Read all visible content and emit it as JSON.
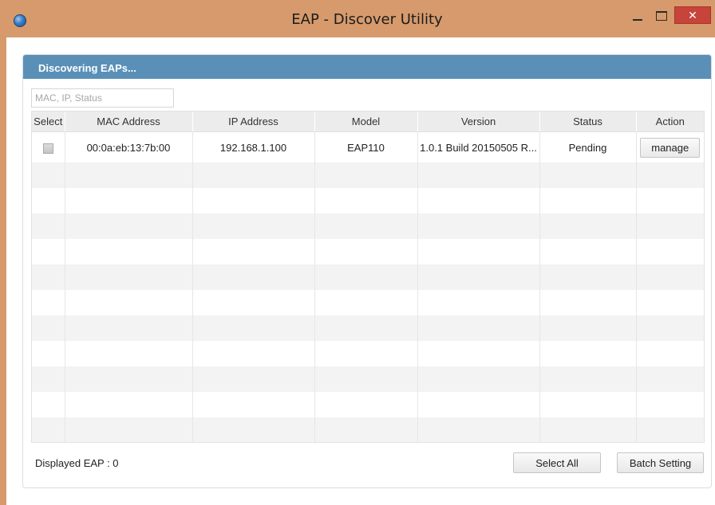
{
  "window": {
    "title": "EAP - Discover Utility",
    "close_glyph": "✕"
  },
  "panel": {
    "header": "Discovering EAPs..."
  },
  "search": {
    "placeholder": "MAC, IP, Status",
    "value": ""
  },
  "table": {
    "columns": [
      "Select",
      "MAC Address",
      "IP Address",
      "Model",
      "Version",
      "Status",
      "Action"
    ],
    "rows": [
      {
        "selected": false,
        "mac": "00:0a:eb:13:7b:00",
        "ip": "192.168.1.100",
        "model": "EAP110",
        "version": "1.0.1 Build 20150505 R...",
        "status": "Pending",
        "action": "manage"
      }
    ]
  },
  "footer": {
    "displayed_label": "Displayed EAP : 0",
    "select_all": "Select All",
    "batch_setting": "Batch Setting"
  },
  "colors": {
    "titlebar": "#d69a6c",
    "header_bar": "#5a90b8",
    "close_button": "#c7443b"
  },
  "icons": {
    "app": "globe-icon",
    "minimize": "minimize-icon",
    "maximize": "maximize-icon",
    "close": "close-icon"
  }
}
